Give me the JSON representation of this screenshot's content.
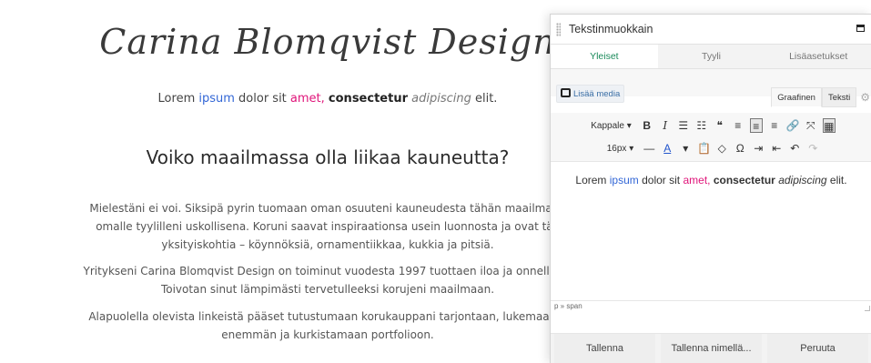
{
  "page": {
    "site_title": "Carina Blomqvist Design",
    "tagline": {
      "w1": "Lorem ",
      "w2": "ipsum",
      "w3": " dolor sit ",
      "w4": "amet,",
      "w5": " ",
      "w6": "consectetur",
      "w7": " ",
      "w8": "adipiscing",
      "w9": " elit."
    },
    "heading": "Voiko maailmassa olla liikaa kauneutta?",
    "paragraphs": [
      [
        "Mielestäni ei voi. Siksipä pyrin tuomaan oman osuuteni kauneudesta tähän maailmaan",
        "omalle tyylilleni uskollisena. Koruni saavat inspiraationsa usein luonnosta ja ovat täy",
        "yksityiskohtia – köynnöksiä, ornamentiikkaa, kukkia ja pitsiä."
      ],
      [
        "Yritykseni Carina Blomqvist Design on toiminut vuodesta 1997 tuottaen iloa ja onnellisuu",
        "Toivotan sinut lämpimästi tervetulleeksi korujeni maailmaan."
      ],
      [
        "Alapuolella olevista linkeistä pääset tutustumaan korukauppani tarjontaan, lukemaan n",
        "enemmän ja kurkistamaan portfolioon."
      ]
    ]
  },
  "editor": {
    "title": "Tekstinmuokkain",
    "tabs": [
      "Yleiset",
      "Tyyli",
      "Lisäasetukset"
    ],
    "active_tab": "Yleiset",
    "add_media": "Lisää media",
    "mode_tabs": [
      "Graafinen",
      "Teksti"
    ],
    "toolbar": {
      "paragraph_select": "Kappale",
      "font_size": "16px",
      "row1": [
        "B",
        "I",
        "☰",
        "☷",
        "❝",
        "≡",
        "≡",
        "≡",
        "🔗",
        "⤧",
        "▦"
      ],
      "row2": [
        "—",
        "A",
        "▾",
        "📋",
        "◇",
        "Ω",
        "⇥",
        "⇤",
        "↶",
        "↷"
      ]
    },
    "content": {
      "w1": "Lorem ",
      "w2": "ipsum",
      "w3": " dolor sit ",
      "w4": "amet,",
      "w5": " ",
      "w6": "consectetur",
      "w7": " ",
      "w8": "adipiscing",
      "w9": " elit."
    },
    "statusbar_path": "p » span",
    "footer_buttons": {
      "save": "Tallenna",
      "save_as": "Tallenna nimellä...",
      "cancel": "Peruuta"
    }
  },
  "colors": {
    "link_blue": "#3367d6",
    "accent_pink": "#e0157a",
    "active_tab_green": "#1a8a5a"
  }
}
